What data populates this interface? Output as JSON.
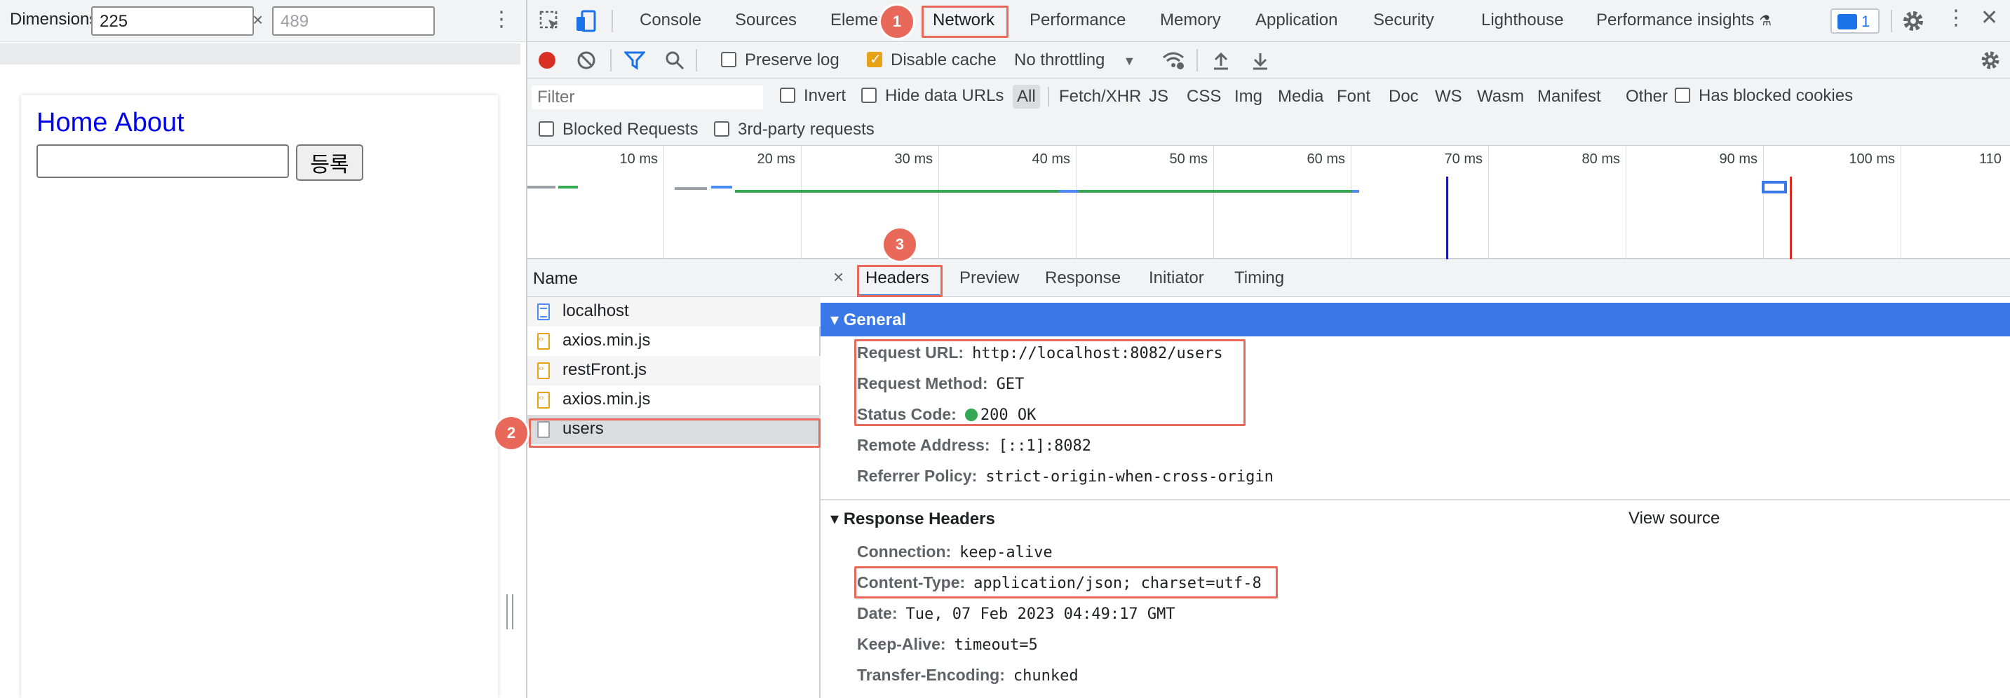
{
  "device_toolbar": {
    "dimensions_label": "Dimensions: R…",
    "dimensions_arrow": "▼",
    "width": "225",
    "height_placeholder": "489",
    "times": "×",
    "more": "⋮"
  },
  "viewport": {
    "nav": [
      "Home",
      "About"
    ],
    "submit_label": "등록"
  },
  "devtools_tabs": [
    "Console",
    "Sources",
    "Elements",
    "Network",
    "Performance",
    "Memory",
    "Application",
    "Security",
    "Lighthouse",
    "Performance insights"
  ],
  "active_tab": "Network",
  "message_count": "1",
  "network_toolbar": {
    "preserve_log": "Preserve log",
    "disable_cache": "Disable cache",
    "throttling": "No throttling",
    "throttling_arrow": "▼"
  },
  "filter": {
    "placeholder": "Filter",
    "invert": "Invert",
    "hide_data_urls": "Hide data URLs",
    "types": [
      "All",
      "Fetch/XHR",
      "JS",
      "CSS",
      "Img",
      "Media",
      "Font",
      "Doc",
      "WS",
      "Wasm",
      "Manifest",
      "Other"
    ],
    "selected_type": "All",
    "has_blocked_cookies": "Has blocked cookies",
    "blocked_requests": "Blocked Requests",
    "third_party": "3rd-party requests"
  },
  "timeline_ticks": [
    "10 ms",
    "20 ms",
    "30 ms",
    "40 ms",
    "50 ms",
    "60 ms",
    "70 ms",
    "80 ms",
    "90 ms",
    "100 ms",
    "110"
  ],
  "request_list": {
    "header": "Name",
    "rows": [
      {
        "name": "localhost",
        "kind": "doc"
      },
      {
        "name": "axios.min.js",
        "kind": "js"
      },
      {
        "name": "restFront.js",
        "kind": "js"
      },
      {
        "name": "axios.min.js",
        "kind": "js"
      },
      {
        "name": "users",
        "kind": "xhr"
      }
    ],
    "selected_index": 4
  },
  "detail_tabs": [
    "Headers",
    "Preview",
    "Response",
    "Initiator",
    "Timing"
  ],
  "detail_close": "×",
  "general": {
    "title": "▾ General",
    "rows": [
      {
        "key": "Request URL:",
        "value": "http://localhost:8082/users"
      },
      {
        "key": "Request Method:",
        "value": "GET"
      },
      {
        "key": "Status Code:",
        "value": "200 OK"
      },
      {
        "key": "Remote Address:",
        "value": "[::1]:8082"
      },
      {
        "key": "Referrer Policy:",
        "value": "strict-origin-when-cross-origin"
      }
    ]
  },
  "response_headers": {
    "title": "▾ Response Headers",
    "view_source": "View source",
    "rows": [
      {
        "key": "Connection:",
        "value": "keep-alive"
      },
      {
        "key": "Content-Type:",
        "value": "application/json; charset=utf-8"
      },
      {
        "key": "Date:",
        "value": "Tue, 07 Feb 2023 04:49:17 GMT"
      },
      {
        "key": "Keep-Alive:",
        "value": "timeout=5"
      },
      {
        "key": "Transfer-Encoding:",
        "value": "chunked"
      }
    ]
  },
  "annotations": [
    "1",
    "2",
    "3"
  ],
  "colors": {
    "accent": "#1a73e8",
    "general_header": "#3b78e7",
    "annotation": "#e8695a",
    "record": "#d93025",
    "status_ok": "#34a853"
  }
}
